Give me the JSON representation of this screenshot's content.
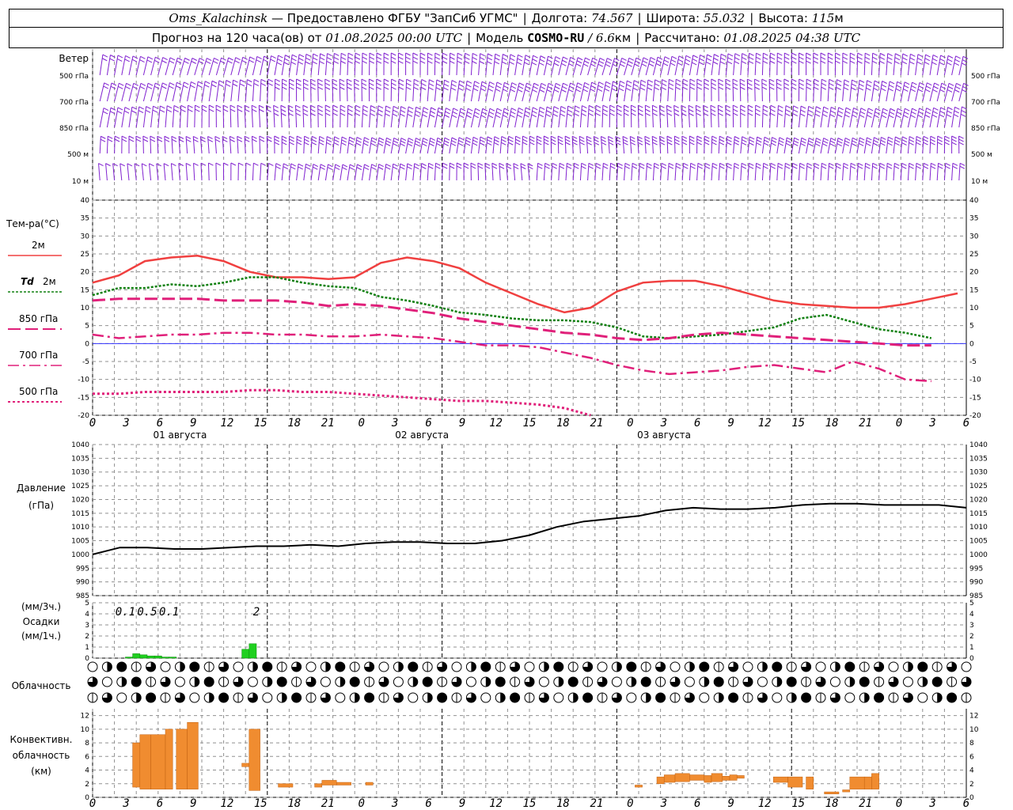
{
  "header": {
    "station": "Oms_Kalachinsk",
    "provider": "— Предоставлено ФГБУ \"ЗапСиб УГМС\"",
    "lon_label": "Долгота:",
    "lon": "74.567",
    "lat_label": "Широта:",
    "lat": "55.032",
    "alt_label": "Высота:",
    "alt": "115",
    "alt_unit": "м",
    "forecast_label": "Прогноз на 120 часа(ов) от",
    "forecast_from": "01.08.2025 00:00 UTC",
    "model_label": "Модель",
    "model": "COSMO-RU",
    "model_res": "/ 6.6",
    "model_res_unit": "км",
    "calc_label": "Рассчитано:",
    "calc_time": "01.08.2025 04:38 UTC"
  },
  "colors": {
    "wind": "#8020d0",
    "t2m": "#f04040",
    "td2m": "#108010",
    "t850": "#e0207a",
    "t700": "#e0207a",
    "t500": "#e0207a",
    "pressure": "#000000",
    "precip": "#20d020",
    "convective": "#f08c30",
    "zero_line": "#3030ff",
    "grid": "#909090"
  },
  "chart_data": [
    {
      "type": "wind_barbs",
      "title": "Ветер",
      "levels": [
        "500 гПа",
        "700 гПа",
        "850 гПа",
        "500 м",
        "10 м"
      ],
      "x_hours": [
        0,
        120
      ]
    },
    {
      "type": "line",
      "ylabel": "Тем-ра(°C)",
      "ylim": [
        -20,
        40
      ],
      "yticks": [
        -20,
        -15,
        -10,
        -5,
        0,
        5,
        10,
        15,
        20,
        25,
        30,
        35,
        40
      ],
      "x": [
        0,
        3,
        6,
        9,
        12,
        15,
        18,
        21,
        24,
        27,
        30,
        33,
        36,
        39,
        42,
        45,
        48,
        51,
        54,
        57,
        60,
        63,
        66,
        69,
        72,
        75,
        78,
        81,
        84,
        87,
        90,
        93,
        96,
        99,
        102,
        105,
        108,
        111,
        114,
        117,
        120
      ],
      "series": [
        {
          "name": "2м",
          "values": [
            17,
            19,
            23,
            24,
            24.5,
            23,
            20,
            18.5,
            18.5,
            18,
            18.5,
            22.5,
            24,
            23,
            21,
            17,
            14,
            11,
            8.7,
            10,
            14.5,
            17,
            17.5,
            17.5,
            16,
            14,
            12,
            11,
            10.5,
            10,
            10,
            11,
            12.5,
            14
          ]
        },
        {
          "name": "Td 2м",
          "values": [
            13.5,
            15.5,
            15.5,
            16.5,
            16,
            17,
            18.5,
            18.5,
            17,
            16,
            15.5,
            13,
            12,
            10.5,
            8.7,
            8,
            7,
            6.5,
            6.5,
            6,
            4.5,
            2,
            1.5,
            2,
            2.5,
            3.5,
            4.5,
            7,
            8,
            6,
            4,
            3,
            1.5
          ]
        },
        {
          "name": "850 гПа",
          "values": [
            12,
            12.5,
            12.5,
            12.5,
            12.5,
            12,
            12,
            12,
            11.5,
            10.5,
            11,
            10.5,
            9.5,
            8.5,
            7,
            6,
            5,
            4,
            3,
            2.5,
            1.5,
            1,
            1.5,
            2.5,
            3,
            2.5,
            2,
            1.5,
            1,
            0.5,
            0,
            -0.5,
            -0.5
          ]
        },
        {
          "name": "700 гПа",
          "values": [
            2.5,
            1.5,
            2,
            2.5,
            2.5,
            3,
            3,
            2.5,
            2.5,
            2,
            2,
            2.5,
            2,
            1.5,
            0.5,
            -0.5,
            -0.5,
            -1,
            -2.5,
            -4,
            -6,
            -7.5,
            -8.5,
            -8,
            -7.5,
            -6.5,
            -6,
            -7,
            -8,
            -5,
            -7,
            -10,
            -10.5
          ]
        },
        {
          "name": "500 гПа",
          "values": [
            -14,
            -14,
            -13.5,
            -13.5,
            -13.5,
            -13.5,
            -13,
            -13,
            -13.5,
            -13.5,
            -14,
            -14.5,
            -15,
            -15.5,
            -16,
            -16,
            -16.5,
            -17,
            -18,
            -20
          ]
        }
      ]
    },
    {
      "type": "line",
      "ylabel": "Давление",
      "yunit": "(гПа)",
      "ylim": [
        985,
        1040
      ],
      "yticks": [
        985,
        990,
        995,
        1000,
        1005,
        1010,
        1015,
        1020,
        1025,
        1030,
        1035,
        1040
      ],
      "series": [
        {
          "name": "Давление",
          "values": [
            1000,
            1002.5,
            1002.5,
            1002,
            1002,
            1002.5,
            1003,
            1003,
            1003.5,
            1003,
            1004,
            1004.5,
            1004.5,
            1004,
            1004,
            1005,
            1007,
            1010,
            1012,
            1013,
            1014,
            1016,
            1017,
            1016.5,
            1016.5,
            1017,
            1018,
            1018.5,
            1018.5,
            1018,
            1018,
            1018,
            1017
          ]
        }
      ]
    },
    {
      "type": "bar",
      "ylabel": "Осадки",
      "yunit_top": "(мм/3ч.)",
      "yunit_bottom": "(мм/1ч.)",
      "ylim": [
        0,
        5
      ],
      "yticks": [
        0,
        1,
        2,
        3,
        4,
        5
      ],
      "labels_3h": [
        {
          "hour": 4.5,
          "text": "0.1"
        },
        {
          "hour": 7.5,
          "text": "0.5"
        },
        {
          "hour": 10.5,
          "text": "0.1"
        },
        {
          "hour": 22.5,
          "text": "2"
        }
      ],
      "hourly": [
        {
          "hour": 5,
          "value": 0.1
        },
        {
          "hour": 6,
          "value": 0.4
        },
        {
          "hour": 7,
          "value": 0.3
        },
        {
          "hour": 8,
          "value": 0.2
        },
        {
          "hour": 9,
          "value": 0.2
        },
        {
          "hour": 10,
          "value": 0.1
        },
        {
          "hour": 11,
          "value": 0.1
        },
        {
          "hour": 21,
          "value": 0.8
        },
        {
          "hour": 22,
          "value": 1.3
        }
      ]
    },
    {
      "type": "table",
      "title": "Облачность",
      "rows": [
        "upper",
        "middle",
        "lower"
      ]
    },
    {
      "type": "bar",
      "ylabel": "Конвективн. облачность",
      "yunit": "(км)",
      "ylim": [
        0,
        13
      ],
      "yticks": [
        0,
        2,
        4,
        6,
        8,
        10,
        12
      ],
      "ranges": [
        {
          "h0": 5.5,
          "h1": 6.5,
          "base": 1.5,
          "top": 8
        },
        {
          "h0": 6.5,
          "h1": 8,
          "base": 1.2,
          "top": 9.2
        },
        {
          "h0": 8,
          "h1": 10,
          "base": 1.2,
          "top": 9.2
        },
        {
          "h0": 10,
          "h1": 11,
          "base": 1.2,
          "top": 10
        },
        {
          "h0": 11.5,
          "h1": 13,
          "base": 1.2,
          "top": 10
        },
        {
          "h0": 13,
          "h1": 14.5,
          "base": 1.2,
          "top": 11
        },
        {
          "h0": 20.5,
          "h1": 21.5,
          "base": 4.5,
          "top": 5
        },
        {
          "h0": 21.5,
          "h1": 23,
          "base": 1,
          "top": 10
        },
        {
          "h0": 25.5,
          "h1": 27.5,
          "base": 1.5,
          "top": 2
        },
        {
          "h0": 30.5,
          "h1": 31.5,
          "base": 1.5,
          "top": 2
        },
        {
          "h0": 31.5,
          "h1": 33.5,
          "base": 1.8,
          "top": 2.5
        },
        {
          "h0": 33.5,
          "h1": 35.5,
          "base": 1.8,
          "top": 2.2
        },
        {
          "h0": 37.5,
          "h1": 38.5,
          "base": 1.8,
          "top": 2.2
        },
        {
          "h0": 74.5,
          "h1": 75.5,
          "base": 1.5,
          "top": 1.8
        },
        {
          "h0": 77.5,
          "h1": 78.5,
          "base": 2,
          "top": 3
        },
        {
          "h0": 78.5,
          "h1": 80,
          "base": 2.2,
          "top": 3.3
        },
        {
          "h0": 80,
          "h1": 82,
          "base": 2.3,
          "top": 3.5
        },
        {
          "h0": 82,
          "h1": 84,
          "base": 2.5,
          "top": 3.3
        },
        {
          "h0": 84,
          "h1": 85,
          "base": 2.2,
          "top": 3.2
        },
        {
          "h0": 85,
          "h1": 86.5,
          "base": 2.3,
          "top": 3.5
        },
        {
          "h0": 86.5,
          "h1": 87.5,
          "base": 2.5,
          "top": 3.1
        },
        {
          "h0": 87.5,
          "h1": 88.5,
          "base": 2.5,
          "top": 3.3
        },
        {
          "h0": 88.5,
          "h1": 89.5,
          "base": 2.8,
          "top": 3.2
        },
        {
          "h0": 93.5,
          "h1": 95.5,
          "base": 2.2,
          "top": 3
        },
        {
          "h0": 95.5,
          "h1": 97.5,
          "base": 1.5,
          "top": 3
        },
        {
          "h0": 98,
          "h1": 99,
          "base": 1.2,
          "top": 3
        },
        {
          "h0": 100.5,
          "h1": 102.5,
          "base": 0.5,
          "top": 0.8
        },
        {
          "h0": 103,
          "h1": 104,
          "base": 0.8,
          "top": 1.1
        },
        {
          "h0": 104,
          "h1": 106,
          "base": 1.2,
          "top": 3
        },
        {
          "h0": 106,
          "h1": 107,
          "base": 1.2,
          "top": 3
        },
        {
          "h0": 107,
          "h1": 108,
          "base": 1.2,
          "top": 3.5
        }
      ]
    }
  ],
  "x_axis": {
    "hour_labels": [
      "0",
      "3",
      "6",
      "9",
      "12",
      "15",
      "18",
      "21",
      "0",
      "3",
      "6",
      "9",
      "12",
      "15",
      "18",
      "21",
      "0",
      "3",
      "6",
      "9",
      "12",
      "15",
      "18",
      "21",
      "0",
      "3",
      "6"
    ],
    "dates": [
      "01 августа",
      "02 августа",
      "03 августа"
    ]
  },
  "legend": {
    "t2m": "2м",
    "td_prefix": "Td",
    "td": "2м",
    "t850": "850 гПа",
    "t700": "700 гПа",
    "t500": "500 гПа"
  }
}
